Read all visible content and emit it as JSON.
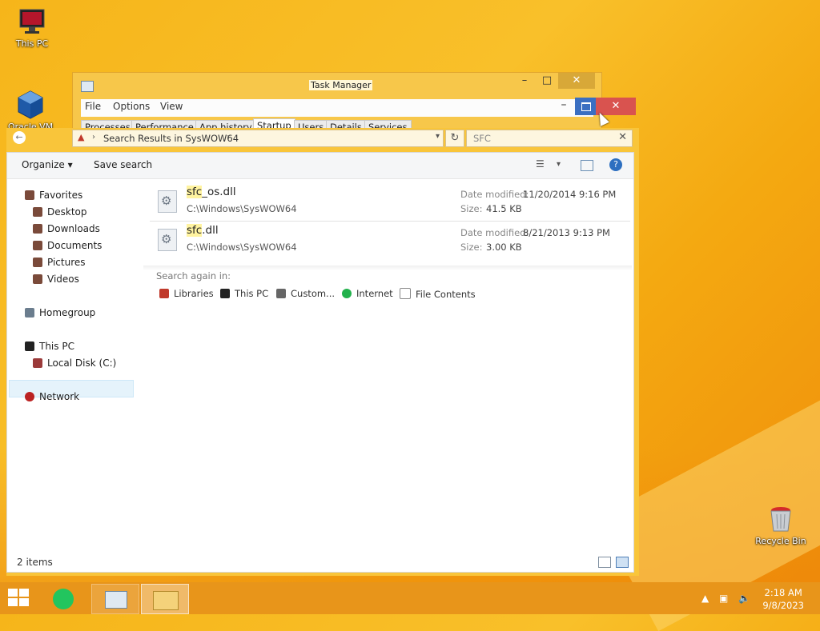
{
  "desktop": {
    "icons": [
      {
        "label": "This PC"
      },
      {
        "label": "Oracle VM VirtualBox"
      },
      {
        "label": "Recycle Bin"
      }
    ]
  },
  "task_manager": {
    "title": "Task Manager",
    "menu": [
      "File",
      "Options",
      "View"
    ],
    "tabs": [
      "Processes",
      "Performance",
      "App history",
      "Startup",
      "Users",
      "Details",
      "Services"
    ],
    "active_tab": "Startup"
  },
  "explorer": {
    "breadcrumb": "Search Results in SysWOW64",
    "search_query": "SFC",
    "toolbar": {
      "organize": "Organize",
      "save_search": "Save search"
    },
    "nav": {
      "favorites": "Favorites",
      "desktop": "Desktop",
      "downloads": "Downloads",
      "documents": "Documents",
      "pictures": "Pictures",
      "videos": "Videos",
      "homegroup": "Homegroup",
      "this_pc": "This PC",
      "local_disk": "Local Disk (C:)",
      "network": "Network"
    },
    "results": [
      {
        "name_hl": "sfc",
        "name_rest": "_os.dll",
        "path": "C:\\Windows\\SysWOW64",
        "date_label": "Date modified:",
        "date": "11/20/2014 9:16 PM",
        "size_label": "Size:",
        "size": "41.5 KB"
      },
      {
        "name_hl": "sfc",
        "name_rest": ".dll",
        "path": "C:\\Windows\\SysWOW64",
        "date_label": "Date modified:",
        "date": "8/21/2013 9:13 PM",
        "size_label": "Size:",
        "size": "3.00 KB"
      }
    ],
    "search_again": {
      "label": "Search again in:",
      "items": [
        "Libraries",
        "This PC",
        "Custom...",
        "Internet",
        "File Contents"
      ]
    },
    "status": {
      "count": "2 items"
    }
  },
  "taskbar": {
    "clock_time": "2:18 AM",
    "clock_date": "9/8/2023"
  },
  "colors": {
    "accent": "#f9c53a",
    "close_red": "#d9534f",
    "maximize_blue": "#3b6fc1",
    "taskbar": "#e8951a"
  }
}
